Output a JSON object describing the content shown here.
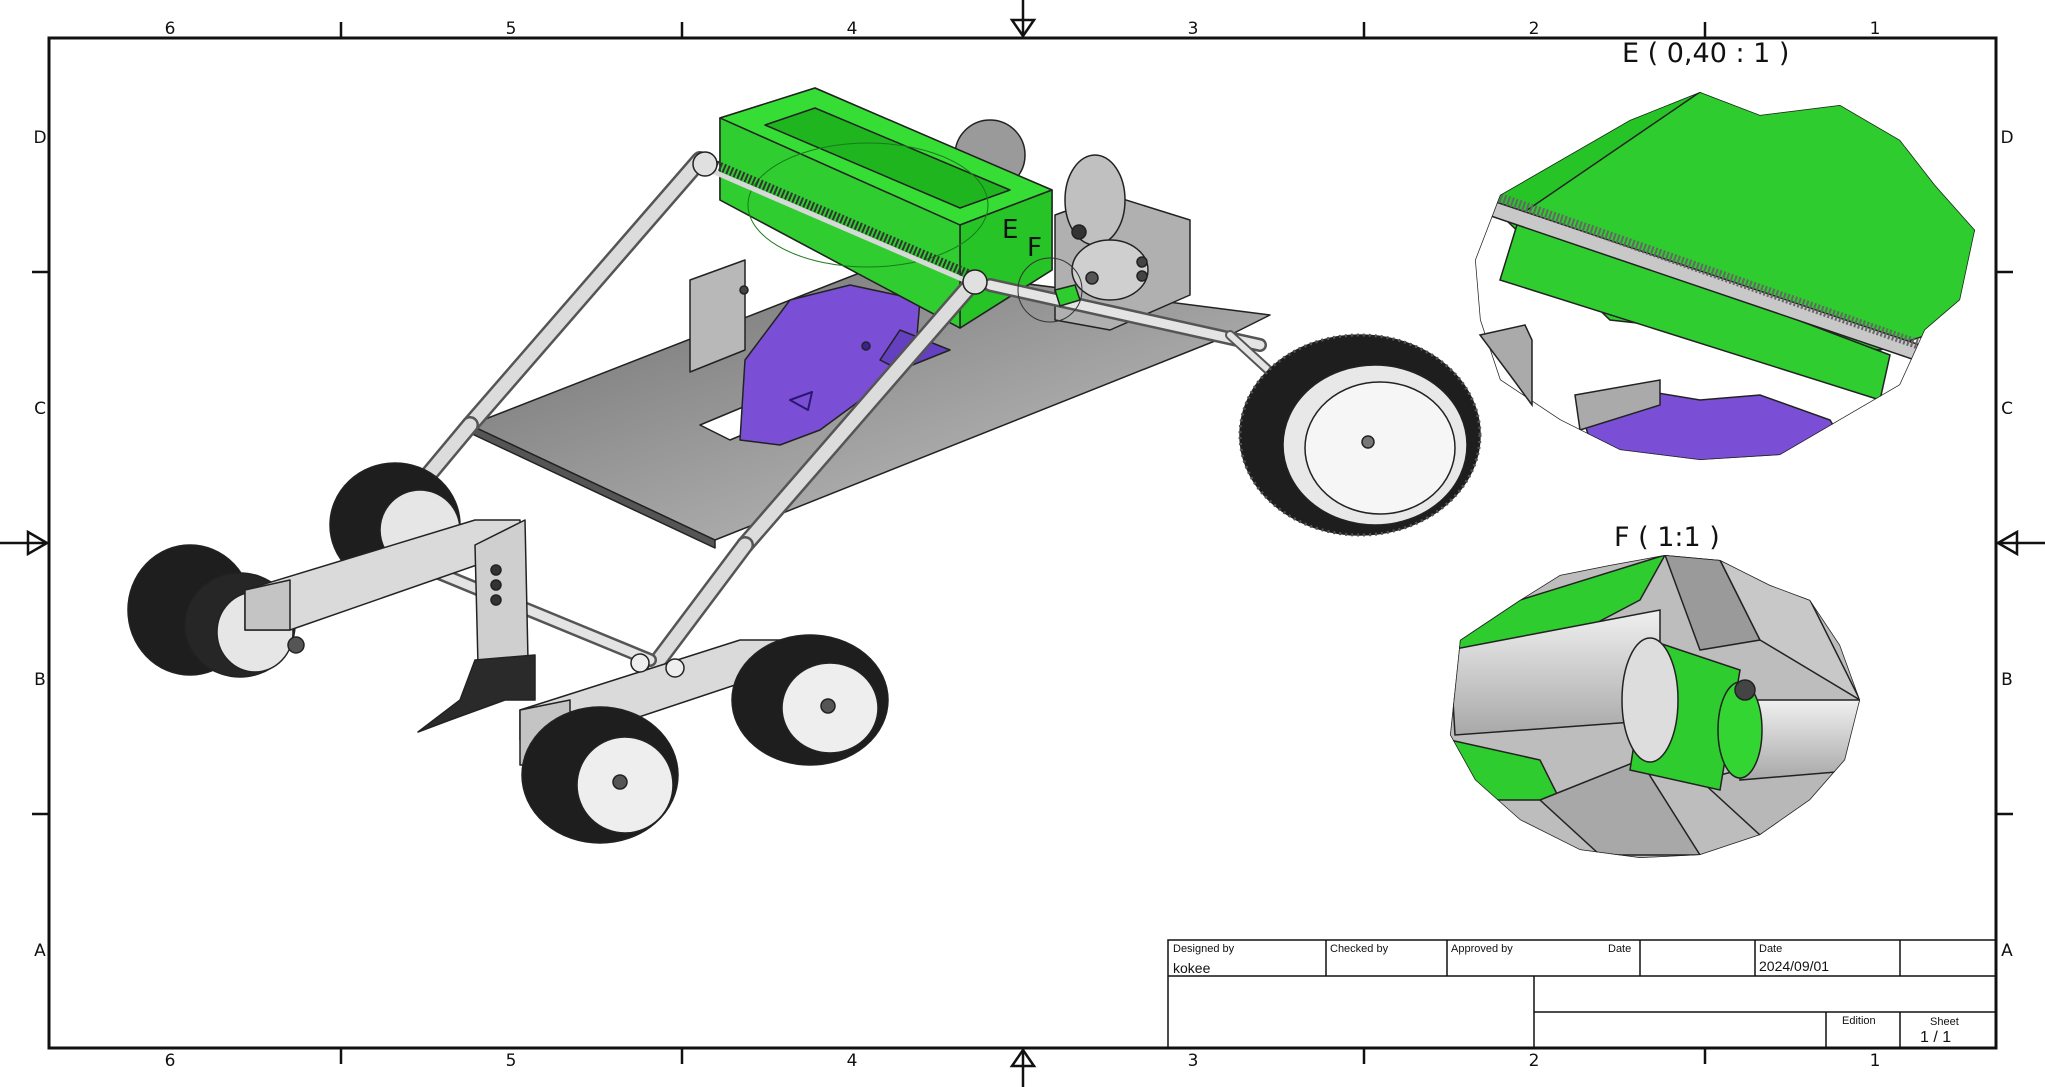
{
  "frame": {
    "column_labels": [
      "6",
      "5",
      "4",
      "3",
      "2",
      "1"
    ],
    "row_labels": [
      "D",
      "C",
      "B",
      "A"
    ]
  },
  "detail_views": {
    "e": {
      "title": "E ( 0,40 : 1 )",
      "callout": "E"
    },
    "f": {
      "title": "F ( 1:1 )",
      "callout": "F"
    }
  },
  "colors": {
    "hopper_green": "#2ecc2e",
    "cam_purple": "#7a4fd6",
    "plate_gray": "#8c8c8c",
    "tire_black": "#1e1e1e",
    "frame_line": "#111111"
  },
  "title_block": {
    "designed_by_label": "Designed by",
    "designed_by_value": "kokee",
    "checked_by_label": "Checked by",
    "approved_by_label": "Approved by",
    "date_label_1": "Date",
    "date_label_2": "Date",
    "date_value": "2024/09/01",
    "edition_label": "Edition",
    "sheet_label": "Sheet",
    "sheet_value": "1 / 1"
  }
}
